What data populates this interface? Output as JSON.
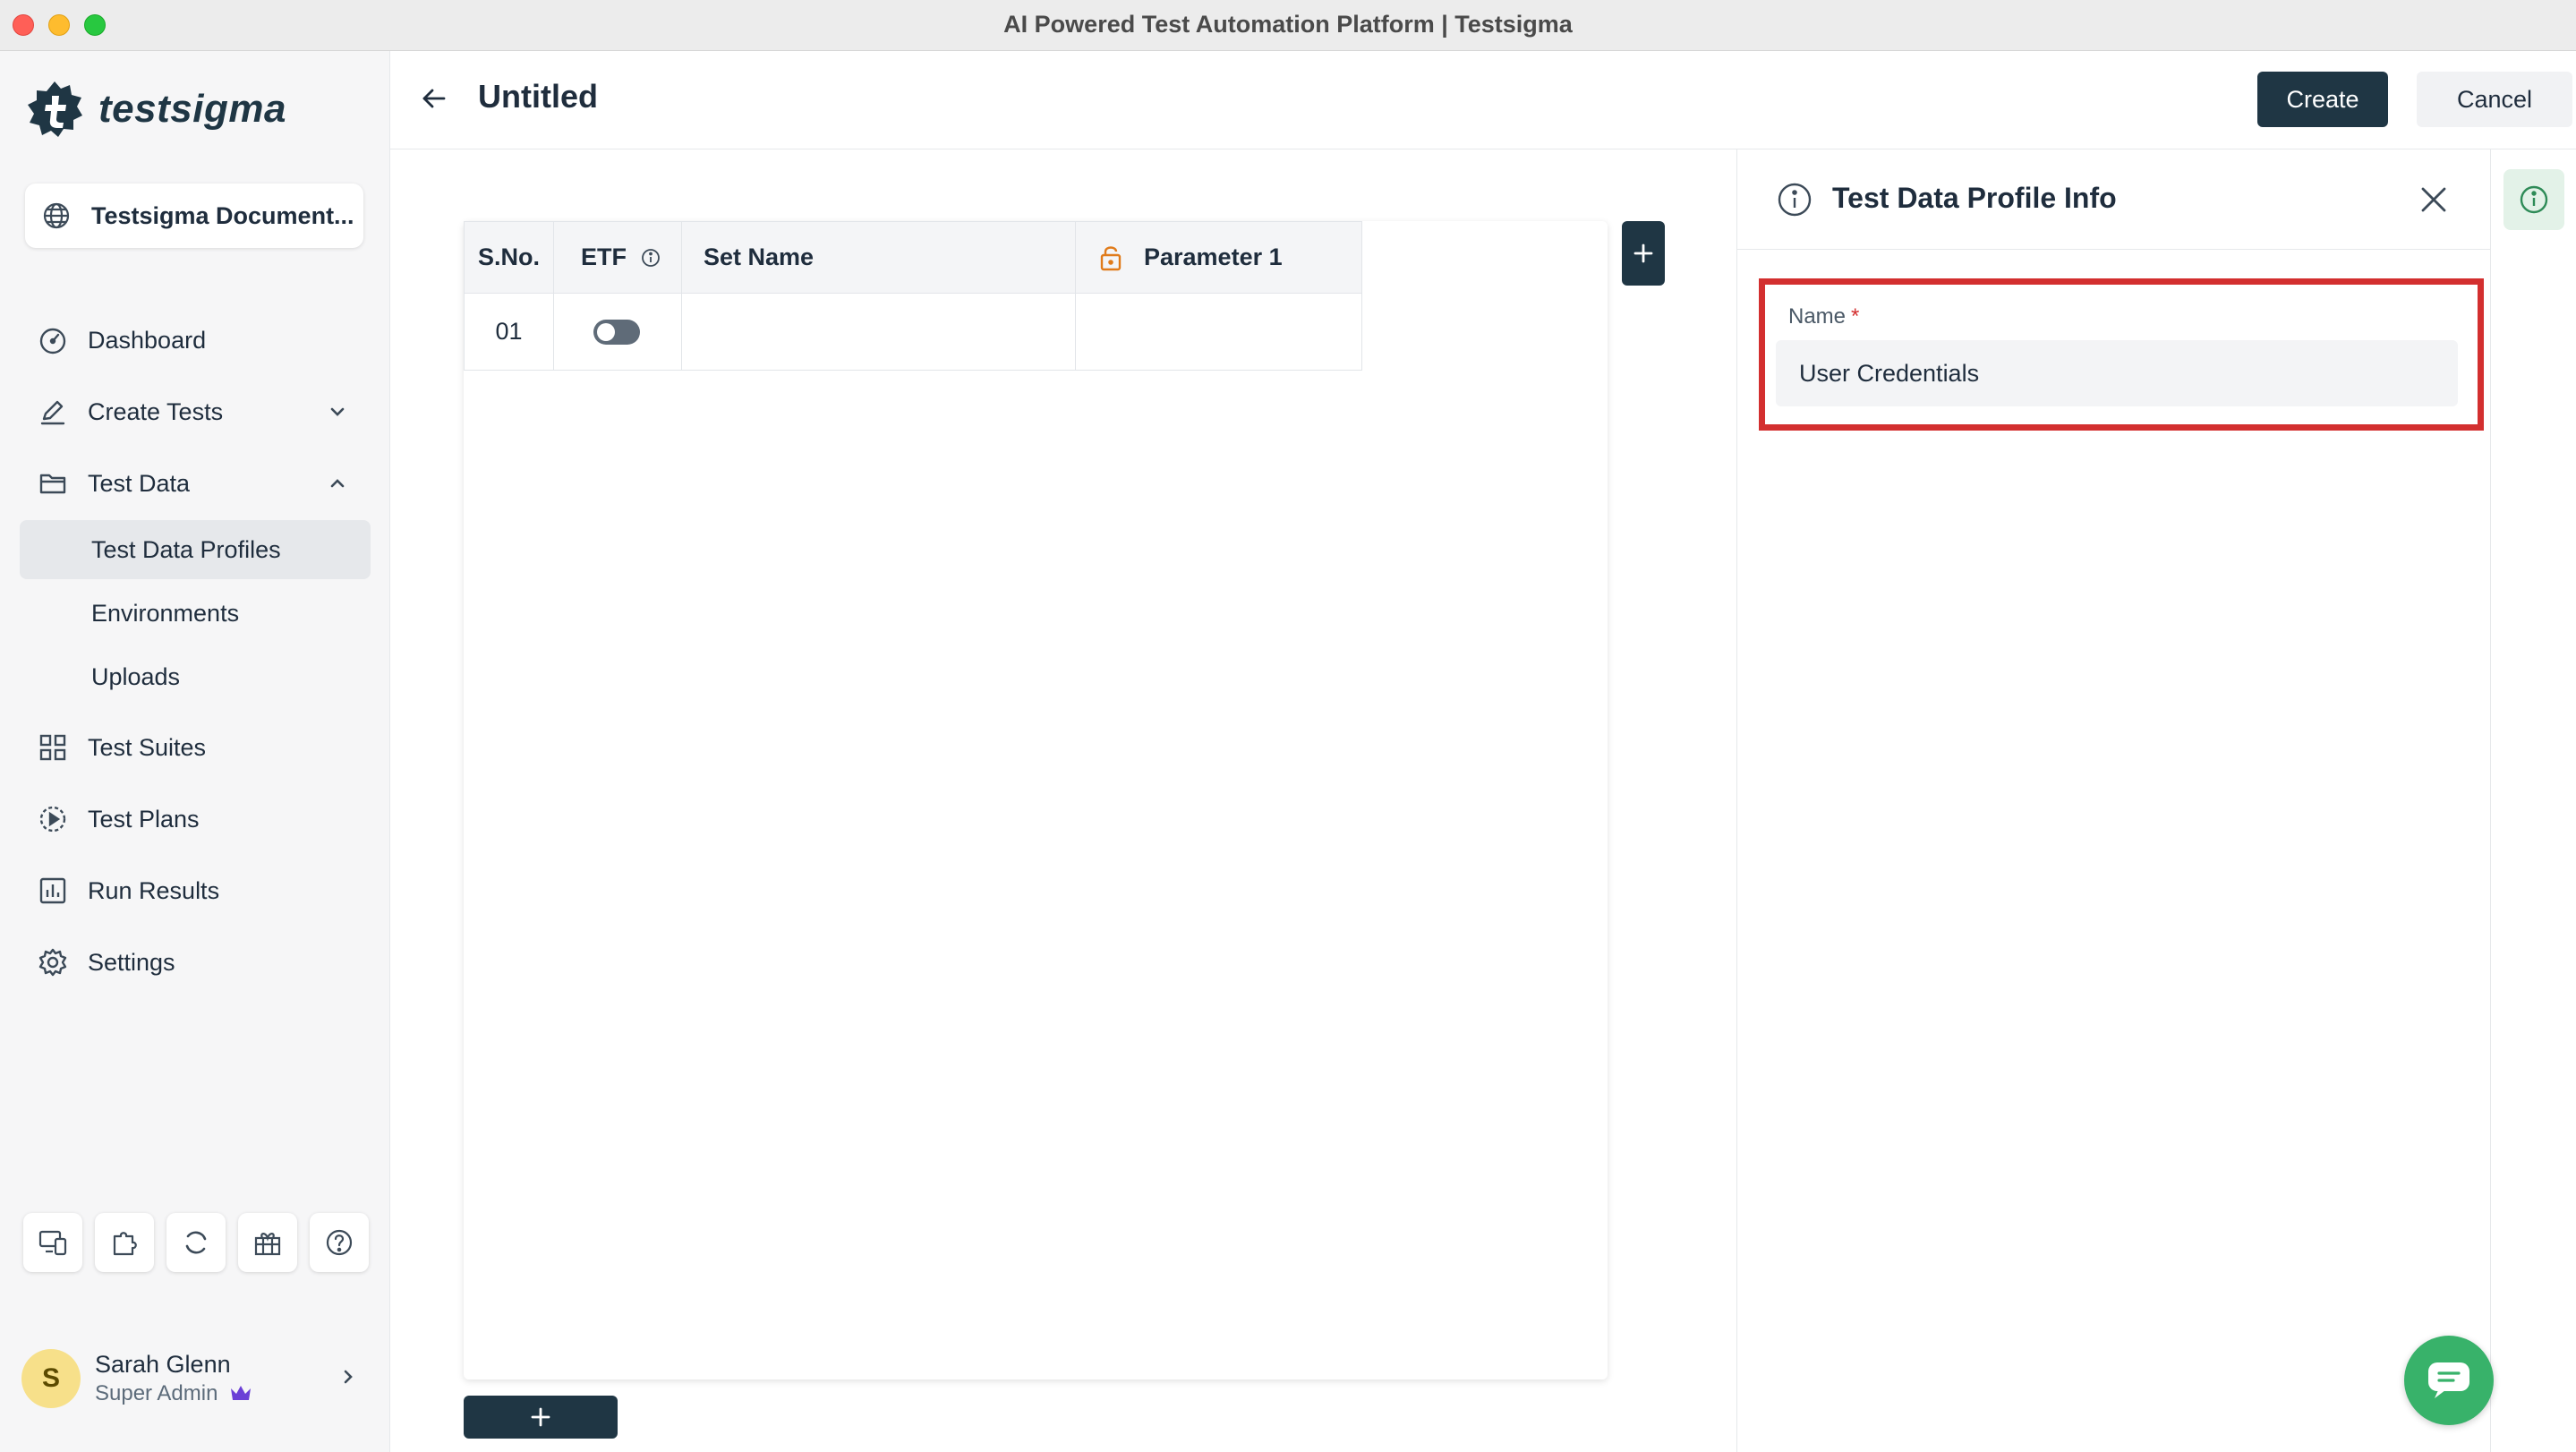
{
  "window": {
    "title": "AI Powered Test Automation Platform | Testsigma"
  },
  "brand": {
    "name": "testsigma",
    "color": "#1f3644"
  },
  "workspace": {
    "label": "Testsigma Document..."
  },
  "sidebar": {
    "items": [
      {
        "label": "Dashboard",
        "icon": "dashboard-gauge-icon"
      },
      {
        "label": "Create Tests",
        "icon": "pencil-icon",
        "expandable": true,
        "expanded": false
      },
      {
        "label": "Test Data",
        "icon": "folder-icon",
        "expandable": true,
        "expanded": true
      },
      {
        "label": "Test Suites",
        "icon": "grid-icon"
      },
      {
        "label": "Test Plans",
        "icon": "play-circle-icon"
      },
      {
        "label": "Run Results",
        "icon": "bar-chart-icon"
      },
      {
        "label": "Settings",
        "icon": "gear-icon"
      }
    ],
    "test_data_children": [
      {
        "label": "Test Data Profiles",
        "active": true
      },
      {
        "label": "Environments",
        "active": false
      },
      {
        "label": "Uploads",
        "active": false
      }
    ],
    "utility_icons": [
      "device-icon",
      "puzzle-icon",
      "sync-icon",
      "gift-icon",
      "help-icon"
    ]
  },
  "user": {
    "initial": "S",
    "name": "Sarah Glenn",
    "role": "Super Admin",
    "role_badge": "crown-icon"
  },
  "header": {
    "title": "Untitled",
    "create_label": "Create",
    "cancel_label": "Cancel"
  },
  "table": {
    "columns": [
      "S.No.",
      "ETF",
      "Set Name",
      "Parameter 1"
    ],
    "rows": [
      {
        "sno": "01",
        "etf_enabled": false,
        "set_name": "",
        "parameter_1": ""
      }
    ]
  },
  "panel": {
    "title": "Test Data Profile Info",
    "name_label": "Name",
    "required_marker": "*",
    "name_value": "User Credentials"
  },
  "colors": {
    "primary": "#1f3644",
    "highlight": "#d32f2f",
    "chat": "#38b26a",
    "lock": "#e07b1a"
  }
}
